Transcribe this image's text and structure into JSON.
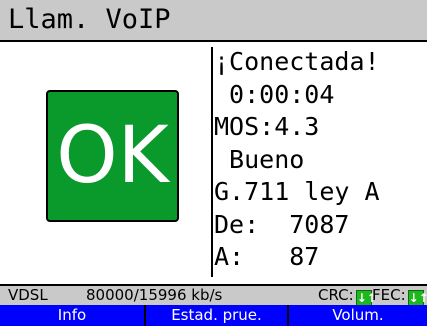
{
  "window": {
    "title": "Llam. VoIP"
  },
  "call": {
    "status_icon_text": "OK",
    "lines": [
      "¡Conectada!",
      " 0:00:04",
      "MOS:4.3",
      " Bueno",
      "G.711 ley A",
      "De:  7087",
      "A:   87"
    ]
  },
  "statusbar": {
    "mode": "VDSL",
    "rate": "80000/15996 kb/s",
    "crc_label": "CRC:",
    "fec_label": "FEC:",
    "arrow_glyph": "↓↑"
  },
  "softkeys": [
    "Info",
    "Estad. prue.",
    "Volum."
  ],
  "colors": {
    "title_bg": "#c9c9c9",
    "ok_bg": "#0a9a2c",
    "softkey_bg": "#0000ff",
    "badge_green": "#1db81d"
  }
}
